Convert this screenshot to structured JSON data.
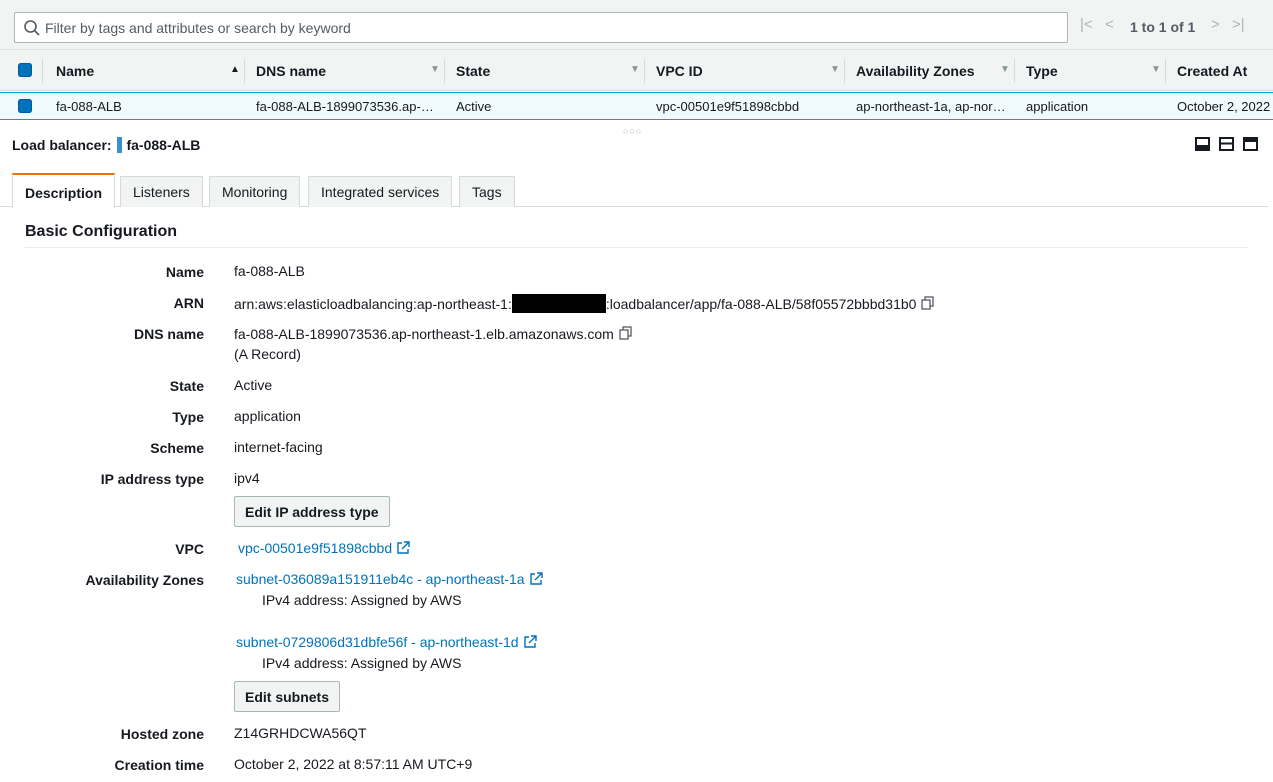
{
  "filter": {
    "placeholder": "Filter by tags and attributes or search by keyword"
  },
  "pagination": {
    "text": "1 to 1 of 1"
  },
  "table": {
    "columns": [
      "Name",
      "DNS name",
      "State",
      "VPC ID",
      "Availability Zones",
      "Type",
      "Created At"
    ],
    "row": {
      "name": "fa-088-ALB",
      "dns": "fa-088-ALB-1899073536.ap-…",
      "state": "Active",
      "vpc": "vpc-00501e9f51898cbbd",
      "azs": "ap-northeast-1a, ap-nor…",
      "type": "application",
      "created": "October 2, 2022"
    }
  },
  "detail": {
    "heading_label": "Load balancer:",
    "heading_name": "fa-088-ALB",
    "tabs": [
      "Description",
      "Listeners",
      "Monitoring",
      "Integrated services",
      "Tags"
    ],
    "section_title": "Basic Configuration",
    "labels": {
      "name": "Name",
      "arn": "ARN",
      "dns": "DNS name",
      "state": "State",
      "type": "Type",
      "scheme": "Scheme",
      "ip_type": "IP address type",
      "vpc": "VPC",
      "azs": "Availability Zones",
      "hosted_zone": "Hosted zone",
      "creation_time": "Creation time"
    },
    "values": {
      "name": "fa-088-ALB",
      "arn_prefix": "arn:aws:elasticloadbalancing:ap-northeast-1:",
      "arn_suffix": ":loadbalancer/app/fa-088-ALB/58f05572bbbd31b0",
      "dns": "fa-088-ALB-1899073536.ap-northeast-1.elb.amazonaws.com",
      "dns_note": "(A Record)",
      "state": "Active",
      "type": "application",
      "scheme": "internet-facing",
      "ip_type": "ipv4",
      "vpc": "vpc-00501e9f51898cbbd",
      "subnet1": "subnet-036089a151911eb4c - ap-northeast-1a",
      "subnet1_ip": "IPv4 address: Assigned by AWS",
      "subnet2": "subnet-0729806d31dbfe56f - ap-northeast-1d",
      "subnet2_ip": "IPv4 address: Assigned by AWS",
      "hosted_zone": "Z14GRHDCWA56QT",
      "creation_time": "October 2, 2022 at 8:57:11 AM UTC+9"
    },
    "buttons": {
      "edit_ip": "Edit IP address type",
      "edit_subnets": "Edit subnets"
    }
  },
  "colors": {
    "link": "#0073bb",
    "tab_accent": "#ec7211",
    "selected_row": "#f1faff",
    "checkbox": "#0073bb"
  }
}
